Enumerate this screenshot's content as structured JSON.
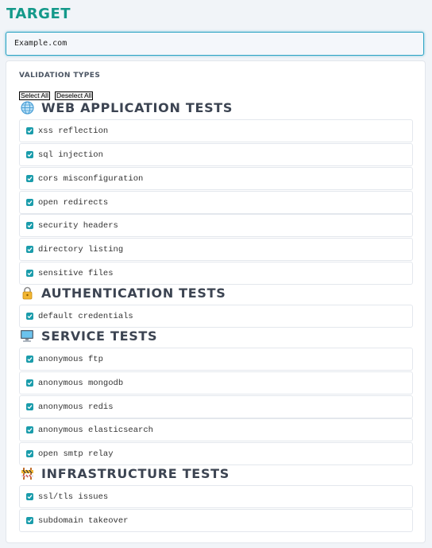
{
  "target": {
    "title": "TARGET",
    "value": "Example.com"
  },
  "validation": {
    "label": "VALIDATION TYPES",
    "select_all": "Select All",
    "deselect_all": "Deselect All"
  },
  "colors": {
    "accent": "#14998a",
    "checkbox": "#1a9cab",
    "input_border": "#2ba3c4"
  },
  "groups": [
    {
      "icon": "globe-icon",
      "title": "WEB APPLICATION TESTS",
      "items": [
        {
          "label": "xss reflection",
          "checked": true
        },
        {
          "label": "sql injection",
          "checked": true
        },
        {
          "label": "cors misconfiguration",
          "checked": true
        },
        {
          "label": "open redirects",
          "checked": true
        },
        {
          "label": "security headers",
          "checked": true
        },
        {
          "label": "directory listing",
          "checked": true
        },
        {
          "label": "sensitive files",
          "checked": true
        }
      ]
    },
    {
      "icon": "lock-icon",
      "title": "AUTHENTICATION TESTS",
      "items": [
        {
          "label": "default credentials",
          "checked": true
        }
      ]
    },
    {
      "icon": "monitor-icon",
      "title": "SERVICE TESTS",
      "items": [
        {
          "label": "anonymous ftp",
          "checked": true
        },
        {
          "label": "anonymous mongodb",
          "checked": true
        },
        {
          "label": "anonymous redis",
          "checked": true
        },
        {
          "label": "anonymous elasticsearch",
          "checked": true
        },
        {
          "label": "open smtp relay",
          "checked": true
        }
      ]
    },
    {
      "icon": "construction-icon",
      "title": "INFRASTRUCTURE TESTS",
      "items": [
        {
          "label": "ssl/tls issues",
          "checked": true
        },
        {
          "label": "subdomain takeover",
          "checked": true
        }
      ]
    }
  ]
}
